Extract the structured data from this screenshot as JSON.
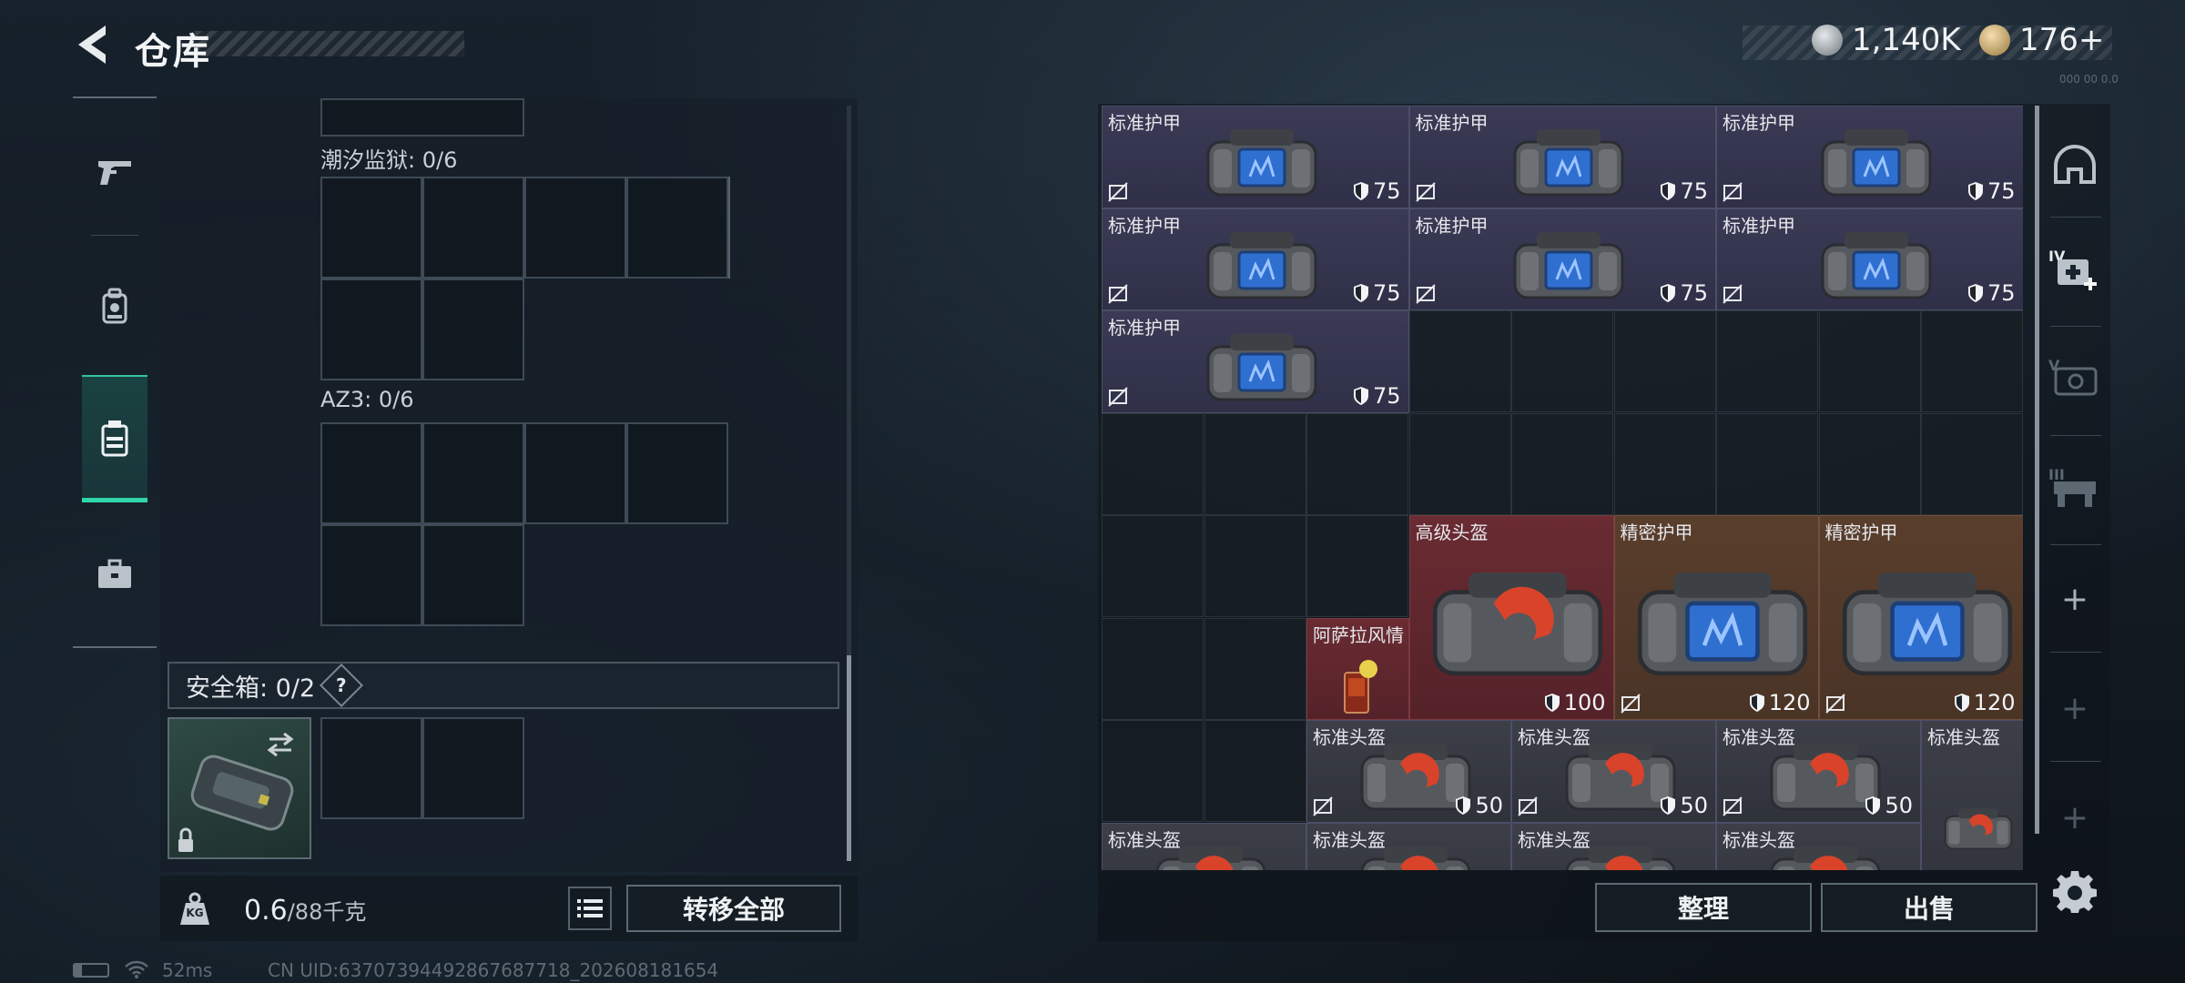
{
  "header": {
    "title": "仓库",
    "currency_silver": "1,140K",
    "currency_gold": "176+",
    "version": "000 00 0.0"
  },
  "sidebar": {
    "tabs": [
      {
        "icon": "gun-icon",
        "active": false
      },
      {
        "icon": "backpack-icon",
        "active": false
      },
      {
        "icon": "container-icon",
        "active": true
      },
      {
        "icon": "briefcase-icon",
        "active": false
      }
    ]
  },
  "containers": [
    {
      "label": "潮汐监狱: 0/6"
    },
    {
      "label": "AZ3: 0/6"
    }
  ],
  "safe_box": {
    "label": "安全箱: 0/2",
    "help": "?"
  },
  "weight": {
    "current": "0.6",
    "max": "/88千克",
    "kg_label": "KG"
  },
  "buttons": {
    "transfer_all": "转移全部",
    "organize": "整理",
    "sell": "出售"
  },
  "status": {
    "ping": "52ms",
    "uid": "CN UID:63707394492867687718_202608181654"
  },
  "inventory_items": [
    {
      "name": "标准护甲",
      "durability": "75"
    },
    {
      "name": "标准护甲",
      "durability": "75"
    },
    {
      "name": "标准护甲",
      "durability": "75"
    },
    {
      "name": "标准护甲",
      "durability": "75"
    },
    {
      "name": "标准护甲",
      "durability": "75"
    },
    {
      "name": "标准护甲",
      "durability": "75"
    },
    {
      "name": "标准护甲",
      "durability": "75"
    },
    {
      "name": "高级头盔",
      "durability": "100"
    },
    {
      "name": "精密护甲",
      "durability": "120"
    },
    {
      "name": "精密护甲",
      "durability": "120"
    },
    {
      "name": "阿萨拉风情",
      "durability": ""
    },
    {
      "name": "标准头盔",
      "durability": "50"
    },
    {
      "name": "标准头盔",
      "durability": "50"
    },
    {
      "name": "标准头盔",
      "durability": "50"
    },
    {
      "name": "标准头盔",
      "durability": ""
    },
    {
      "name": "标准头盔",
      "durability": ""
    },
    {
      "name": "标准头盔",
      "durability": ""
    },
    {
      "name": "标准头盔",
      "durability": ""
    },
    {
      "name": "标准头盔",
      "durability": ""
    }
  ],
  "right_tabs": [
    {
      "icon": "helmet-icon",
      "label": ""
    },
    {
      "icon": "medkit-icon",
      "label": "IV"
    },
    {
      "icon": "armor-case-icon",
      "label": "V"
    },
    {
      "icon": "storage-icon",
      "label": "III"
    }
  ],
  "colors": {
    "accent": "#2fd6a8",
    "tier_std": "#3a3a55",
    "tier_red": "#6a2b32",
    "tier_orange": "#5a3e2c"
  }
}
